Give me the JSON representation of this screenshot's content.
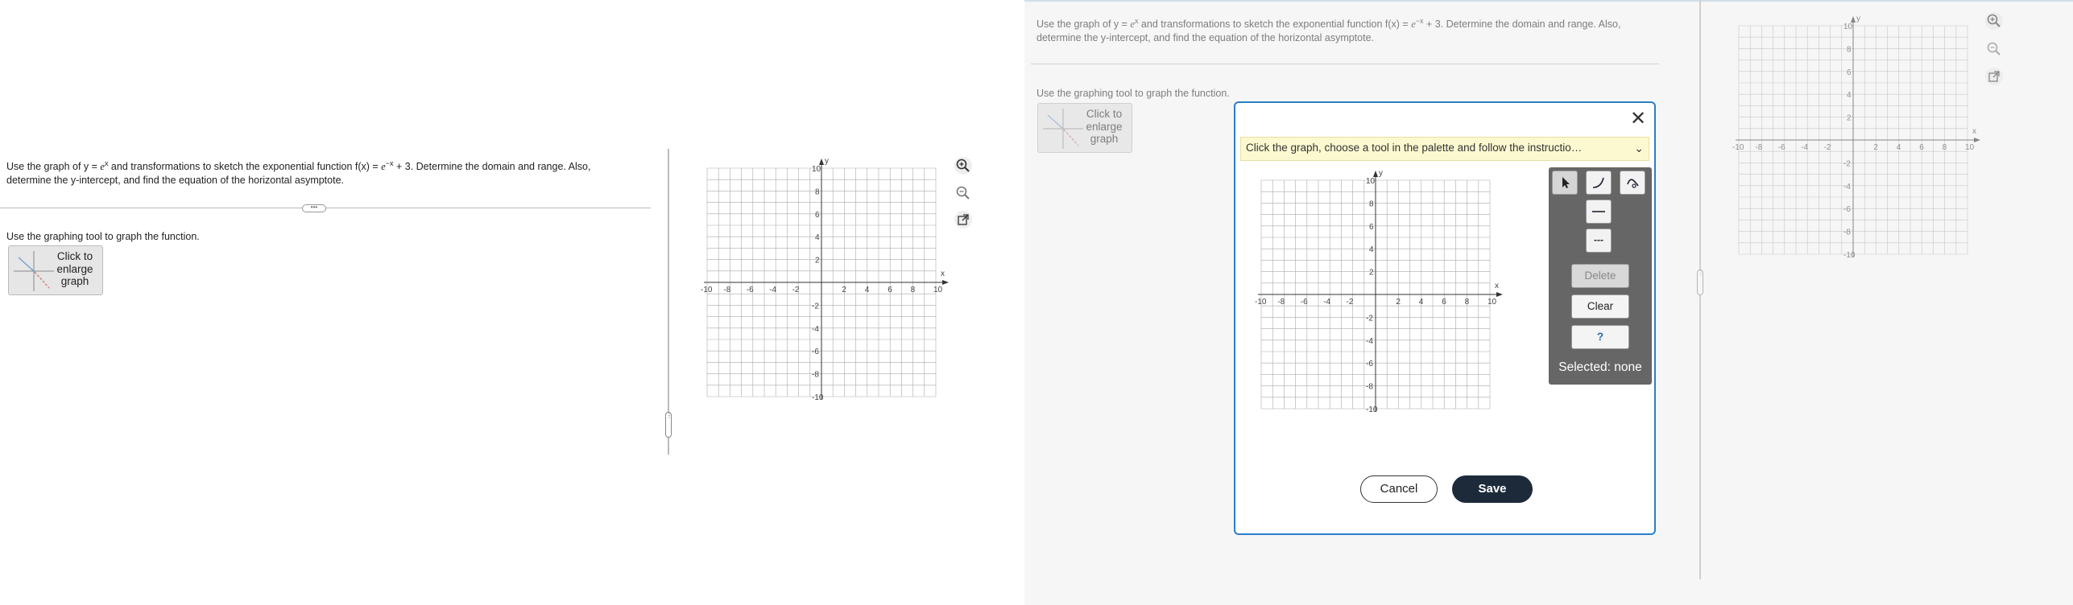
{
  "question": {
    "pre": "Use the graph of y = ",
    "base": "e",
    "exp1": "x",
    "mid": " and transformations to sketch the exponential function f(x) = ",
    "base2": "e",
    "exp2": "−x",
    "post": " + 3. Determine the domain and range. Also,",
    "line2": "determine the y-intercept, and find the equation of the horizontal asymptote.",
    "expand_dots": "•••"
  },
  "instruction": "Use the graphing tool to graph the function.",
  "enlarge": {
    "line1": "Click to",
    "line2": "enlarge",
    "line3": "graph"
  },
  "graph": {
    "x_range": [
      -10,
      10
    ],
    "y_range": [
      -10,
      10
    ],
    "grid_step": 1,
    "tick_label_step": 2,
    "x_label": "x",
    "y_label": "y",
    "x_ticks": [
      "-10",
      "-8",
      "-6",
      "-4",
      "-2",
      "2",
      "4",
      "6",
      "8",
      "10"
    ],
    "y_ticks_pos": [
      "10",
      "8",
      "6",
      "4",
      "2"
    ],
    "y_ticks_neg": [
      "-2",
      "-4",
      "-6",
      "-8",
      "-10"
    ]
  },
  "tools": {
    "zoom_in": "zoom-in-icon",
    "zoom_out": "zoom-out-icon",
    "popout": "external-link-icon"
  },
  "splitter_dots": "⋮",
  "modal": {
    "hint": "Click the graph, choose a tool in the palette and follow the instructio…",
    "palette": {
      "tools": [
        "pointer-tool",
        "curve-tool",
        "asymptote-tool",
        "line-tool",
        "dashed-line-tool"
      ],
      "dash_glyph": "---",
      "delete": "Delete",
      "clear": "Clear",
      "help": "?",
      "selected": "Selected: none"
    },
    "cancel": "Cancel",
    "save": "Save"
  },
  "colors": {
    "accent_blue": "#2a7fc6",
    "save_bg": "#1c2a3a",
    "hint_bg": "#fcf9d1",
    "palette_bg": "#666666"
  }
}
